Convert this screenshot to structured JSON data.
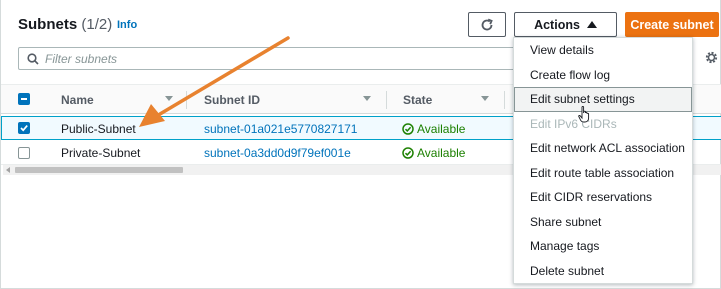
{
  "header": {
    "title": "Subnets",
    "count": "(1/2)",
    "info_label": "Info"
  },
  "toolbar": {
    "refresh_icon": "refresh-icon",
    "actions_label": "Actions",
    "create_label": "Create subnet",
    "create_color": "#ec7211"
  },
  "filter": {
    "placeholder": "Filter subnets",
    "value": ""
  },
  "table": {
    "columns": [
      "Name",
      "Subnet ID",
      "State"
    ],
    "rows": [
      {
        "selected": true,
        "name": "Public-Subnet",
        "subnet_id": "subnet-01a021e5770827171",
        "state": "Available"
      },
      {
        "selected": false,
        "name": "Private-Subnet",
        "subnet_id": "subnet-0a3dd0d9f79ef001e",
        "state": "Available"
      }
    ],
    "header_checkbox": "indeterminate"
  },
  "actions_menu": {
    "items": [
      {
        "label": "View details",
        "disabled": false
      },
      {
        "label": "Create flow log",
        "disabled": false
      },
      {
        "label": "Edit subnet settings",
        "disabled": false,
        "hovered": true
      },
      {
        "label": "Edit IPv6 CIDRs",
        "disabled": true
      },
      {
        "label": "Edit network ACL association",
        "disabled": false
      },
      {
        "label": "Edit route table association",
        "disabled": false
      },
      {
        "label": "Edit CIDR reservations",
        "disabled": false
      },
      {
        "label": "Share subnet",
        "disabled": false
      },
      {
        "label": "Manage tags",
        "disabled": false
      },
      {
        "label": "Delete subnet",
        "disabled": false
      }
    ]
  },
  "colors": {
    "link": "#0073bb",
    "success": "#1d8102",
    "annotation_arrow": "#e8822f"
  }
}
